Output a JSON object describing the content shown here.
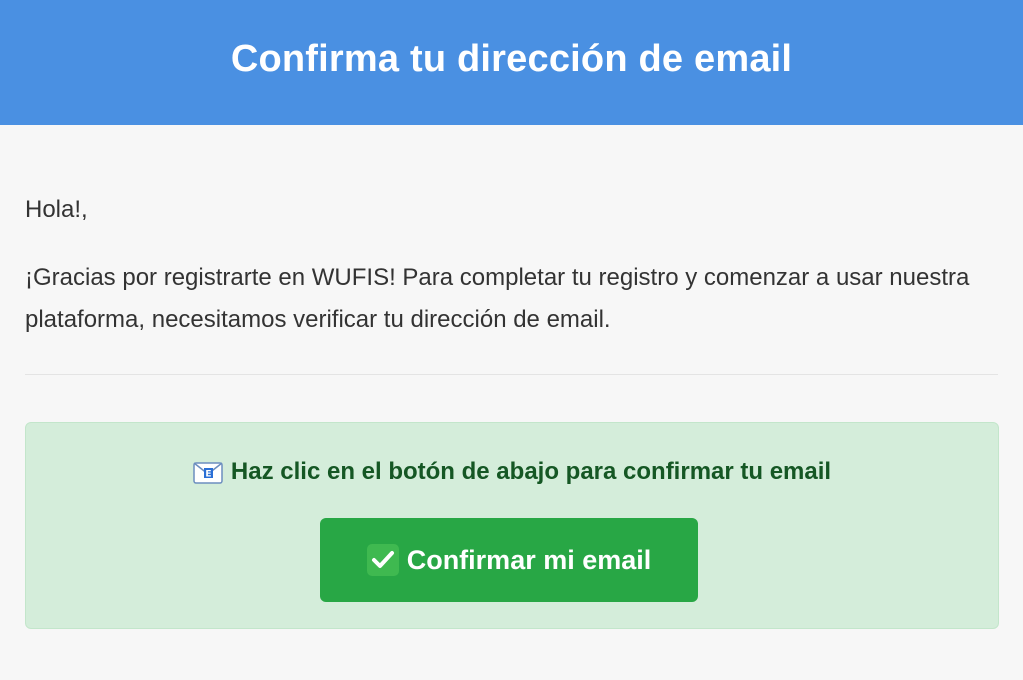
{
  "header": {
    "title": "Confirma tu dirección de email"
  },
  "body": {
    "greeting": "Hola!,",
    "intro": "¡Gracias por registrarte en WUFIS! Para completar tu registro y comenzar a usar nuestra plataforma, necesitamos verificar tu dirección de email."
  },
  "cta": {
    "instruction": "Haz clic en el botón de abajo para confirmar tu email",
    "instruction_icon": "envelope-icon",
    "button_label": "Confirmar mi email",
    "button_icon": "check-icon"
  },
  "colors": {
    "header_bg": "#4a90e2",
    "cta_bg": "#d4edda",
    "cta_text": "#155724",
    "button_bg": "#28a745"
  }
}
